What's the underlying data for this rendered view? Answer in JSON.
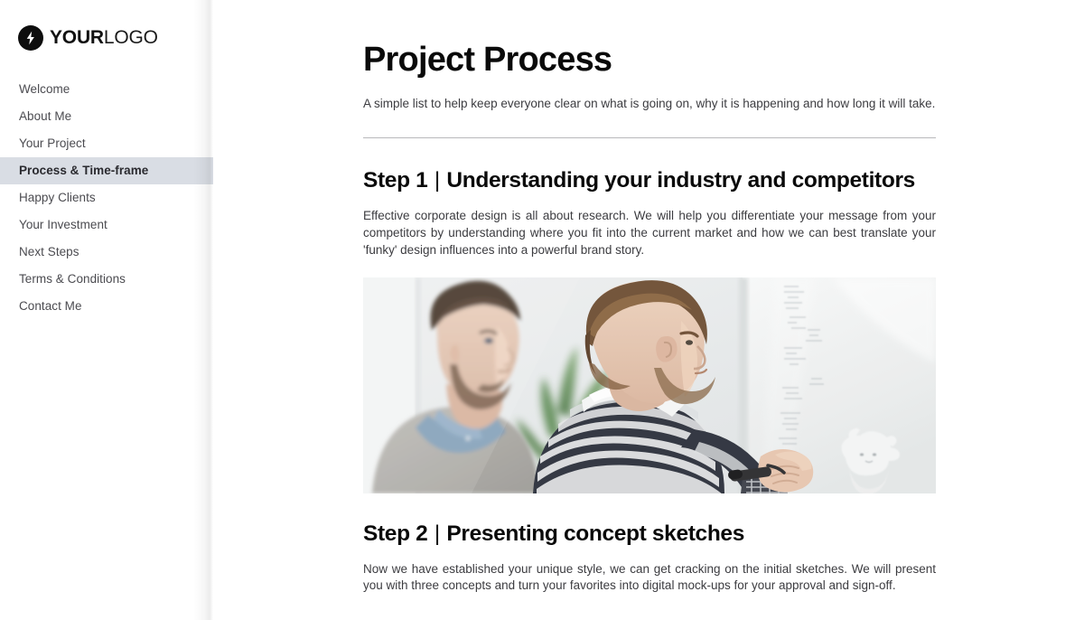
{
  "brand": {
    "logo_icon": "lightning-bolt-icon",
    "name_bold": "YOUR",
    "name_light": "LOGO"
  },
  "sidebar": {
    "items": [
      {
        "label": "Welcome",
        "active": false
      },
      {
        "label": "About Me",
        "active": false
      },
      {
        "label": "Your Project",
        "active": false
      },
      {
        "label": "Process & Time-frame",
        "active": true
      },
      {
        "label": "Happy Clients",
        "active": false
      },
      {
        "label": "Your Investment",
        "active": false
      },
      {
        "label": "Next Steps",
        "active": false
      },
      {
        "label": "Terms & Conditions",
        "active": false
      },
      {
        "label": "Contact Me",
        "active": false
      }
    ],
    "active_bg": "#d9dde4"
  },
  "main": {
    "title": "Project Process",
    "subtitle": "A simple list to help keep everyone clear on what is going on, why it is happening and how long it will take.",
    "steps": [
      {
        "label": "Step 1",
        "separator": "|",
        "title": "Understanding your industry and competitors",
        "body": "Effective corporate design is all about research. We will help you differentiate your message from your competitors by understanding where you fit into the current market and how we can best translate your 'funky' design influences into a powerful brand story.",
        "image_alt": "two-men-at-whiteboard-photo"
      },
      {
        "label": "Step 2",
        "separator": "|",
        "title": "Presenting concept sketches",
        "body": "Now we have established your unique style, we can get cracking on the initial sketches. We will present you with three concepts and turn your favorites into digital mock-ups for your approval and sign-off.",
        "image_alt": ""
      }
    ]
  },
  "colors": {
    "background": "#ffffff",
    "text_dark": "#0a0a0a",
    "text_body": "#3c3c40",
    "nav_text": "#4b4b50",
    "divider": "#b8b8bb"
  }
}
